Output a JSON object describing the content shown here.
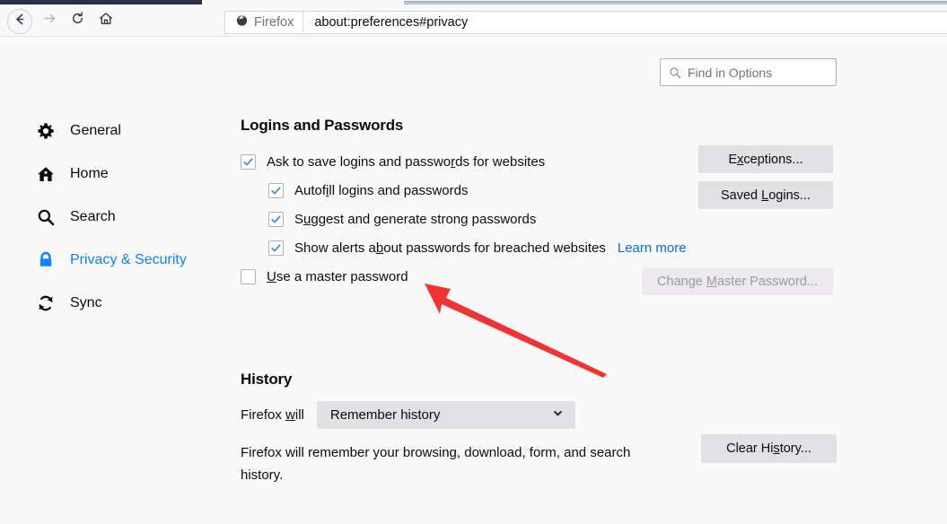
{
  "browser": {
    "nav": {
      "back_icon": "arrow-left-icon",
      "forward_icon": "arrow-right-icon",
      "reload_icon": "reload-icon",
      "home_icon": "home-icon"
    },
    "urlbar": {
      "brand_icon": "firefox-logo-icon",
      "brand_label": "Firefox",
      "url": "about:preferences#privacy"
    }
  },
  "search": {
    "icon": "search-icon",
    "placeholder": "Find in Options",
    "value": ""
  },
  "sidebar": {
    "items": [
      {
        "label": "General",
        "icon": "gear-icon",
        "active": false
      },
      {
        "label": "Home",
        "icon": "home-icon",
        "active": false
      },
      {
        "label": "Search",
        "icon": "search-icon",
        "active": false
      },
      {
        "label": "Privacy & Security",
        "icon": "lock-icon",
        "active": true
      },
      {
        "label": "Sync",
        "icon": "sync-icon",
        "active": false
      }
    ]
  },
  "logins_section": {
    "title": "Logins and Passwords",
    "options": [
      {
        "label": "Ask to save logins and passwords for websites",
        "checked": true,
        "indent": false
      },
      {
        "label": "Autofill logins and passwords",
        "checked": true,
        "indent": true
      },
      {
        "label": "Suggest and generate strong passwords",
        "checked": true,
        "indent": true
      },
      {
        "label": "Show alerts about passwords for breached websites",
        "checked": true,
        "indent": true
      },
      {
        "label": "Use a master password",
        "checked": false,
        "indent": false
      }
    ],
    "learn_more_label": "Learn more",
    "buttons": {
      "exceptions": "Exceptions...",
      "saved_logins": "Saved Logins...",
      "change_master_password": "Change Master Password..."
    }
  },
  "history_section": {
    "title": "History",
    "prefix_label": "Firefox will",
    "dropdown_value": "Remember history",
    "dropdown_icon": "chevron-down-icon",
    "description": "Firefox will remember your browsing, download, form, and search history.",
    "clear_button": "Clear History..."
  },
  "annotation": {
    "arrow_color": "#f03434",
    "target": "Use a master password"
  },
  "colors": {
    "accent": "#0a84ff",
    "link": "#0a6cd8",
    "background": "#f9f9fa",
    "button": "#e1e1e3"
  }
}
